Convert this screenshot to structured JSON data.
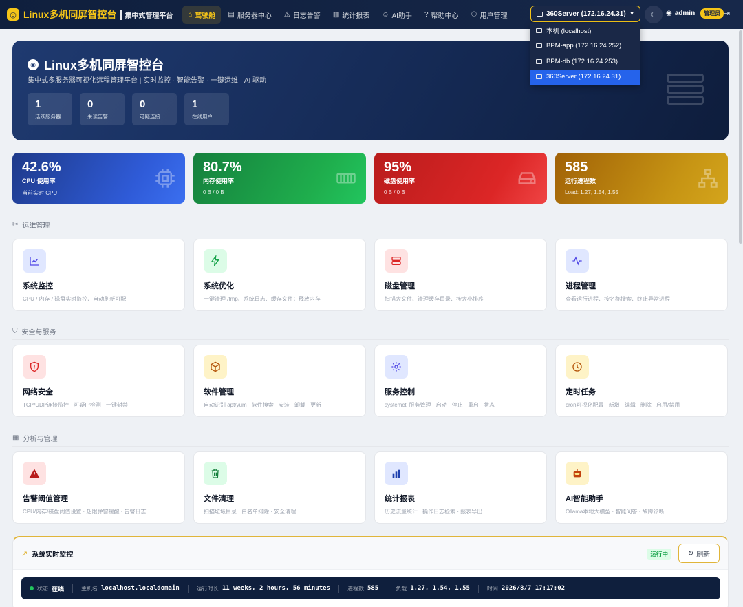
{
  "nav": {
    "brand_title": "Linux多机同屏智控台",
    "brand_sub": "集中式管理平台",
    "items": [
      {
        "label": "驾驶舱",
        "icon": "dashboard-icon",
        "glyph": "⌂"
      },
      {
        "label": "服务器中心",
        "icon": "database-icon",
        "glyph": "▤"
      },
      {
        "label": "日志告警",
        "icon": "warning-icon",
        "glyph": "⚠"
      },
      {
        "label": "统计报表",
        "icon": "bar-chart-icon",
        "glyph": "▥"
      },
      {
        "label": "AI助手",
        "icon": "robot-icon",
        "glyph": "☺"
      },
      {
        "label": "帮助中心",
        "icon": "help-icon",
        "glyph": "?"
      },
      {
        "label": "用户管理",
        "icon": "users-icon",
        "glyph": "⚇"
      }
    ],
    "server_selected": "360Server (172.16.24.31)",
    "user": "admin",
    "role": "管理员"
  },
  "dropdown": {
    "options": [
      "本机 (localhost)",
      "BPM-app (172.16.24.252)",
      "BPM-db (172.16.24.253)",
      "360Server (172.16.24.31)"
    ],
    "selected_index": 3
  },
  "hero": {
    "title": "Linux多机同屏智控台",
    "subtitle": "集中式多服务器可视化远程管理平台 | 实时监控 · 智能告警 · 一键运维 · AI 驱动",
    "stats": [
      {
        "value": "1",
        "label": "活跃服务器"
      },
      {
        "value": "0",
        "label": "未读告警"
      },
      {
        "value": "0",
        "label": "可疑连接"
      },
      {
        "value": "1",
        "label": "在线用户"
      }
    ]
  },
  "metrics": [
    {
      "value": "42.6%",
      "label": "CPU 使用率",
      "sub": "当前实时 CPU"
    },
    {
      "value": "80.7%",
      "label": "内存使用率",
      "sub": "0 B / 0 B"
    },
    {
      "value": "95%",
      "label": "磁盘使用率",
      "sub": "0 B / 0 B"
    },
    {
      "value": "585",
      "label": "运行进程数",
      "sub": "Load: 1.27, 1.54, 1.55"
    }
  ],
  "sections": [
    {
      "title": "运维管理",
      "cards": [
        {
          "title": "系统监控",
          "desc": "CPU / 内存 / 磁盘实时监控、自动刷新可配",
          "icon": "chart-line-icon"
        },
        {
          "title": "系统优化",
          "desc": "一键清理 /tmp、系统日志、缓存文件；释放内存",
          "icon": "bolt-icon"
        },
        {
          "title": "磁盘管理",
          "desc": "扫描大文件、清理缓存目录、按大小排序",
          "icon": "hard-drive-icon"
        },
        {
          "title": "进程管理",
          "desc": "查看运行进程、按名称搜索、终止异常进程",
          "icon": "activity-icon"
        }
      ]
    },
    {
      "title": "安全与服务",
      "cards": [
        {
          "title": "网络安全",
          "desc": "TCP/UDP连接监控 · 可疑IP检测 · 一键封禁",
          "icon": "shield-icon"
        },
        {
          "title": "软件管理",
          "desc": "自动识别 apt/yum · 软件搜索 · 安装 · 卸载 · 更新",
          "icon": "package-icon"
        },
        {
          "title": "服务控制",
          "desc": "systemctl 服务管理 · 启动 · 停止 · 重启 · 状态",
          "icon": "settings-icon"
        },
        {
          "title": "定时任务",
          "desc": "cron可视化配置 · 新增 · 编辑 · 删除 · 启用/禁用",
          "icon": "clock-icon"
        }
      ]
    },
    {
      "title": "分析与管理",
      "cards": [
        {
          "title": "告警阈值管理",
          "desc": "CPU/内存/磁盘阈值设置 · 超限弹窗提醒 · 告警日志",
          "icon": "alert-triangle-icon"
        },
        {
          "title": "文件清理",
          "desc": "扫描垃圾目录 · 白名单排除 · 安全清理",
          "icon": "trash-icon"
        },
        {
          "title": "统计报表",
          "desc": "历史流量统计 · 操作日志检索 · 报表导出",
          "icon": "bar-chart-icon"
        },
        {
          "title": "AI智能助手",
          "desc": "Ollama本地大模型 · 智能问答 · 故障诊断",
          "icon": "robot-icon"
        }
      ]
    }
  ],
  "monitor": {
    "title": "系统实时监控",
    "status_badge": "运行中",
    "refresh_label": "刷新",
    "status_label": "状态",
    "status_value": "在线",
    "host_label": "主机名",
    "host_value": "localhost.localdomain",
    "uptime_label": "运行时长",
    "uptime_value": "11 weeks, 2 hours, 56 minutes",
    "proc_label": "进程数",
    "proc_value": "585",
    "load_label": "负载",
    "load_value": "1.27, 1.54, 1.55",
    "time_label": "时间",
    "time_value": "2026/8/7 17:17:02"
  }
}
